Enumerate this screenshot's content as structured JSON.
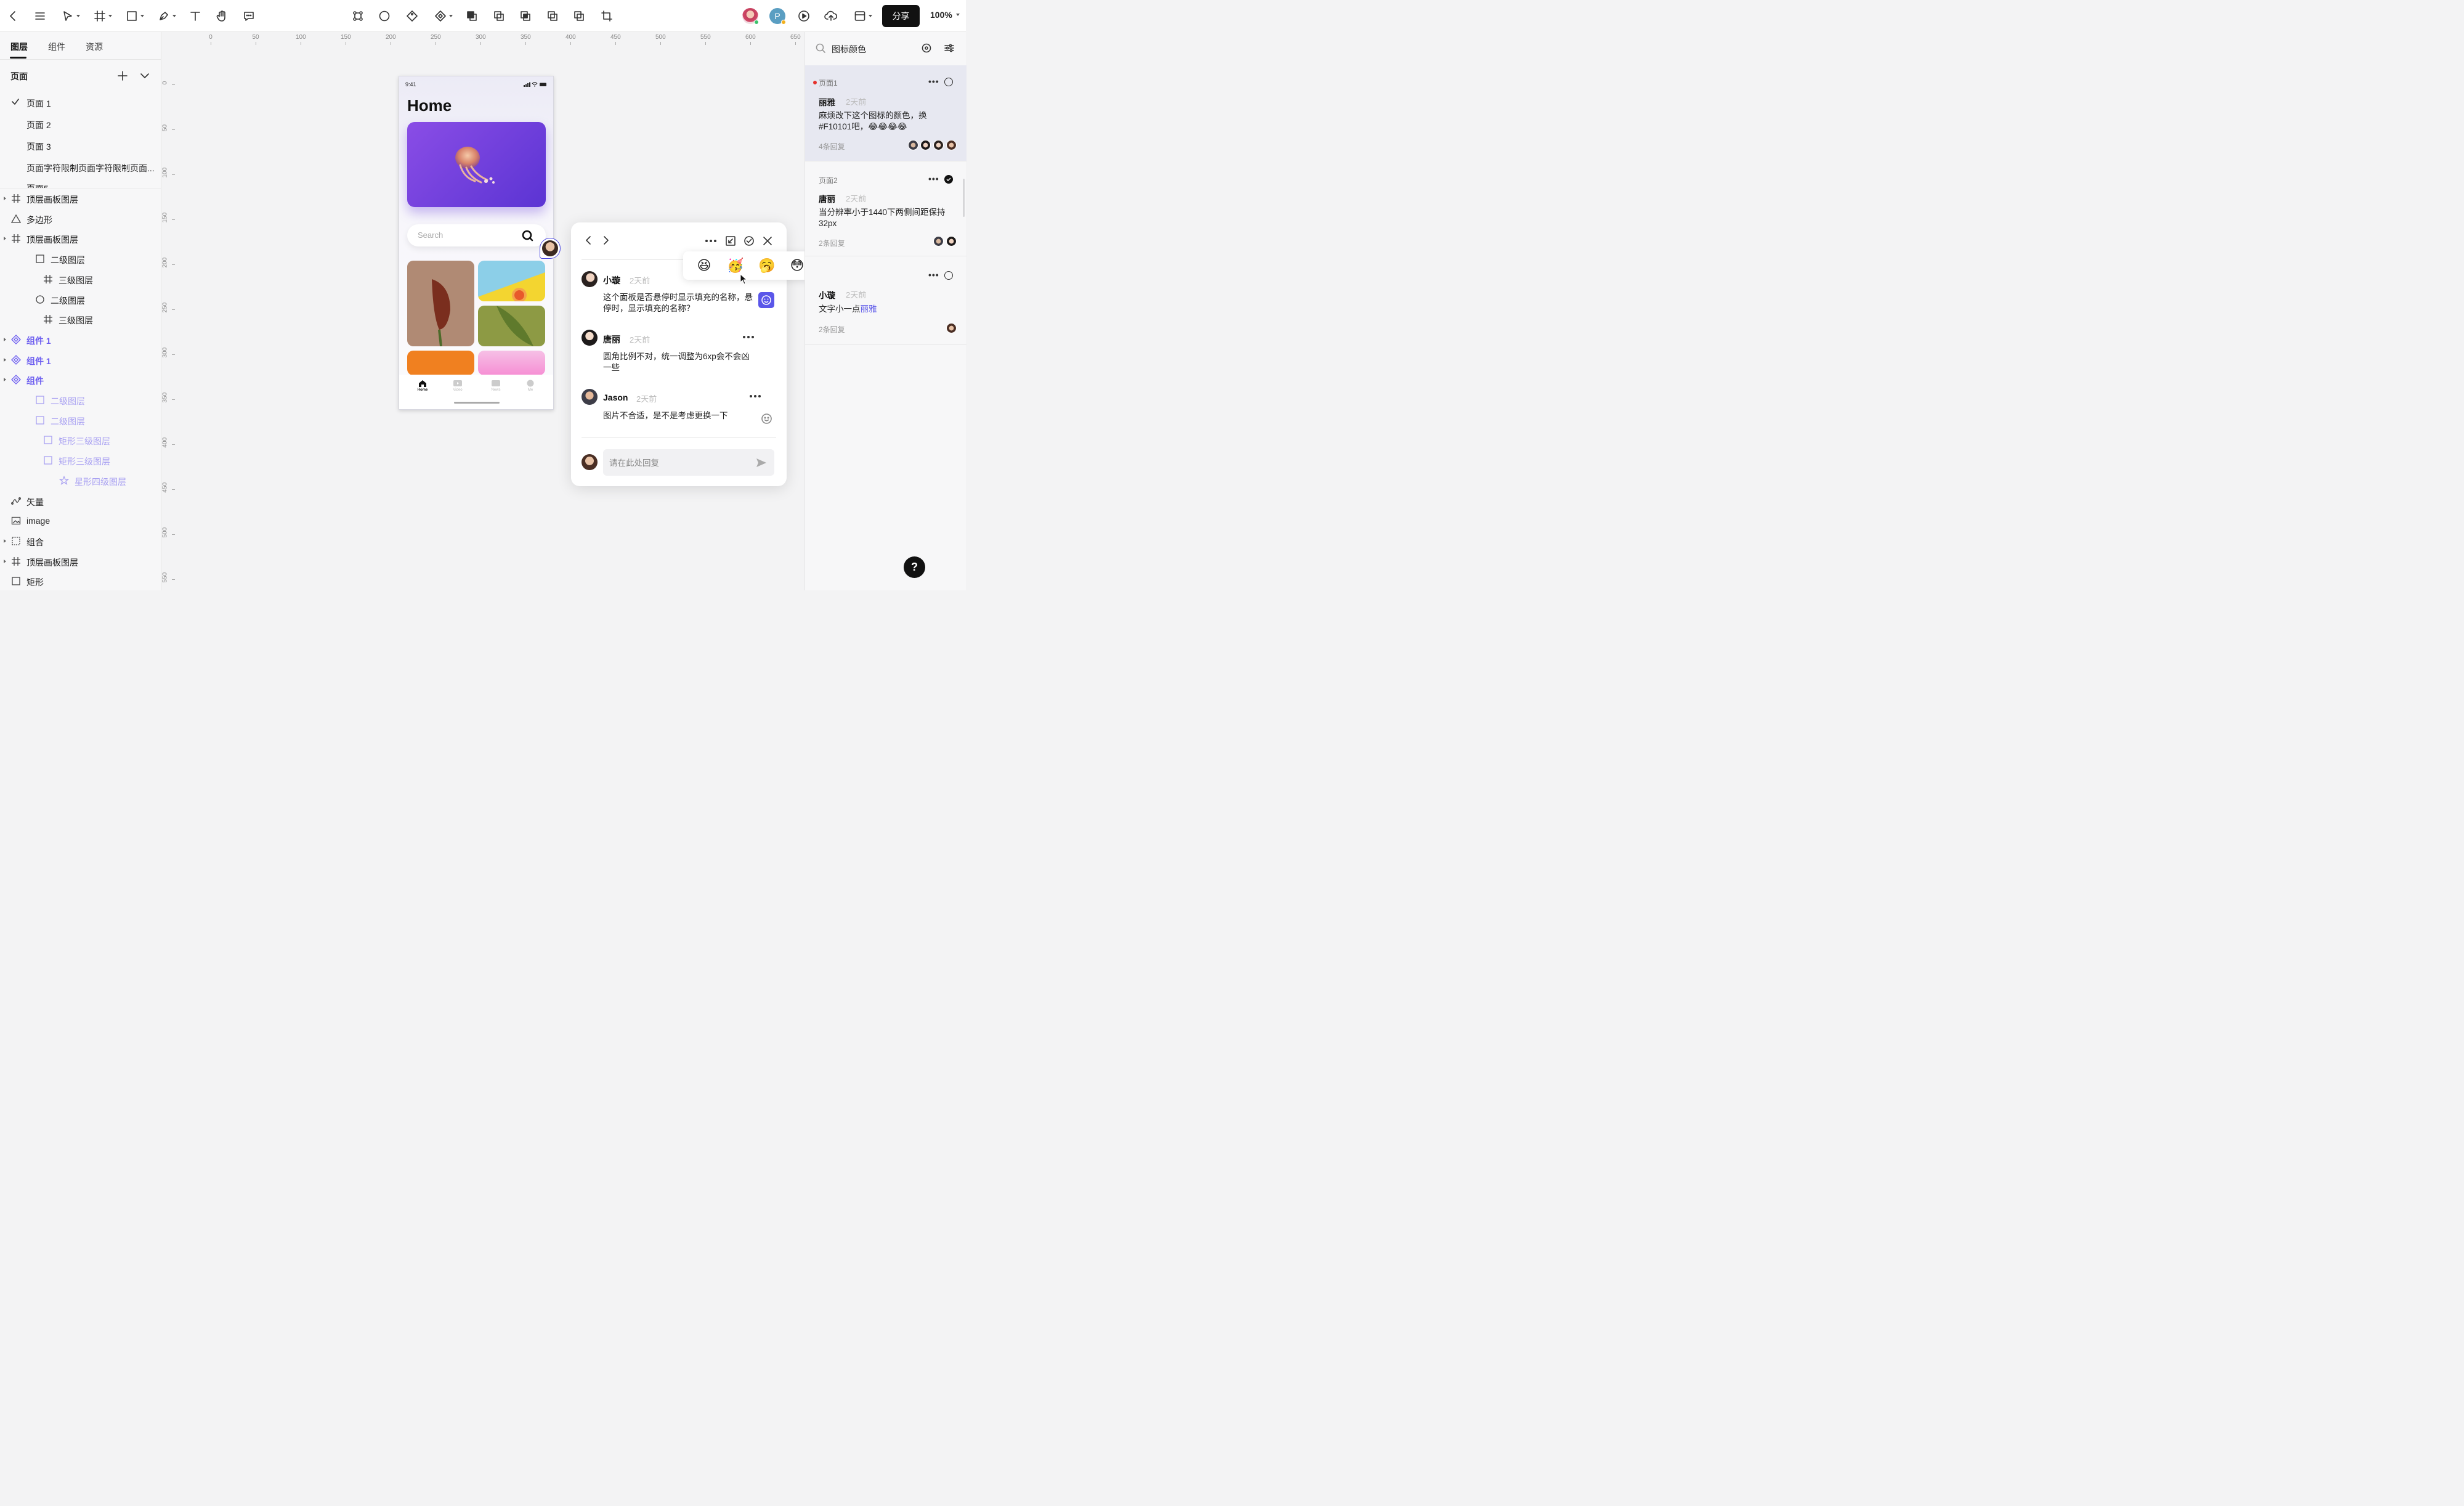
{
  "toolbar": {
    "back": "back",
    "share_label": "分享",
    "zoom": "100%",
    "icons": [
      "chevron-left-icon",
      "menu-icon",
      "pointer-icon",
      "frame-icon",
      "rectangle-icon",
      "pen-icon",
      "text-icon",
      "hand-icon",
      "comment-icon",
      "component-icon",
      "ellipse-icon",
      "rotate-icon",
      "move-icon",
      "union-icon",
      "subtract-icon",
      "intersect-icon",
      "exclude-icon",
      "flatten-icon",
      "crop-icon",
      "play-icon",
      "upload-icon",
      "layout-icon"
    ],
    "avatar_initial": "P"
  },
  "left_panel": {
    "tabs": [
      "图层",
      "组件",
      "资源"
    ],
    "pages_header": "页面",
    "pages": [
      "页面 1",
      "页面 2",
      "页面 3",
      "页面字符限制页面字符限制页面...",
      "页面5"
    ],
    "layers": [
      {
        "label": "顶层画板图层",
        "icon": "frame-icon"
      },
      {
        "label": "多边形",
        "icon": "triangle-icon"
      },
      {
        "label": "顶层画板图层",
        "icon": "frame-icon"
      },
      {
        "label": "二级图层",
        "icon": "rect-icon"
      },
      {
        "label": "三级图层",
        "icon": "frame-icon"
      },
      {
        "label": "二级图层",
        "icon": "circle-icon"
      },
      {
        "label": "三级图层",
        "icon": "frame-icon"
      },
      {
        "label": "组件 1",
        "icon": "component-icon"
      },
      {
        "label": "组件 1",
        "icon": "component-icon"
      },
      {
        "label": "组件",
        "icon": "component-icon"
      },
      {
        "label": "二级图层",
        "icon": "rect-icon"
      },
      {
        "label": "二级图层",
        "icon": "rect-icon"
      },
      {
        "label": "矩形三级图层",
        "icon": "rect-icon"
      },
      {
        "label": "矩形三级图层",
        "icon": "rect-icon"
      },
      {
        "label": "星形四级图层",
        "icon": "star-icon"
      },
      {
        "label": "矢量",
        "icon": "vector-icon"
      },
      {
        "label": "image",
        "icon": "image-icon"
      },
      {
        "label": "组合",
        "icon": "group-icon"
      },
      {
        "label": "顶层画板图层",
        "icon": "frame-icon"
      },
      {
        "label": "矩形",
        "icon": "rect-icon"
      }
    ]
  },
  "rulers": {
    "h": [
      "0",
      "50",
      "100",
      "150",
      "200",
      "250",
      "300",
      "350",
      "400",
      "450",
      "500",
      "550",
      "600",
      "650"
    ],
    "v": [
      "0",
      "50",
      "100",
      "150",
      "200",
      "250",
      "300",
      "350",
      "400",
      "450",
      "500",
      "550"
    ]
  },
  "phone": {
    "time": "9:41",
    "title": "Home",
    "search_placeholder": "Search",
    "tabs": [
      "Home",
      "Video",
      "News",
      "Me"
    ]
  },
  "comment_popup": {
    "comments": [
      {
        "name": "小璇",
        "time": "2天前",
        "text": "这个面板是否悬停时显示填充的名称，悬停时，显示填充的名称？"
      },
      {
        "name": "唐丽",
        "time": "2天前",
        "text": "圆角比例不对，统一调整为6xp会不会凶一些"
      },
      {
        "name": "Jason",
        "time": "2天前",
        "text": "图片不合适，是不是考虑更换一下"
      }
    ],
    "reply_placeholder": "请在此处回复",
    "emojis": [
      "😆",
      "🥳",
      "🥱",
      "😳",
      "😲"
    ]
  },
  "right_panel": {
    "search_value": "图标颜色",
    "threads": [
      {
        "page": "页面1",
        "name": "丽雅",
        "time": "2天前",
        "text": "麻烦改下这个图标的颜色，换#F10101吧，😂😂😂😂",
        "count": "4条回复"
      },
      {
        "page": "页面2",
        "name": "唐丽",
        "time": "2天前",
        "text": "当分辨率小于1440下两侧间距保持32px",
        "count": "2条回复"
      },
      {
        "page": "",
        "name": "小璇",
        "time": "2天前",
        "text": "文字小一点",
        "mention": "丽雅",
        "count": "2条回复"
      }
    ]
  },
  "help": "?"
}
